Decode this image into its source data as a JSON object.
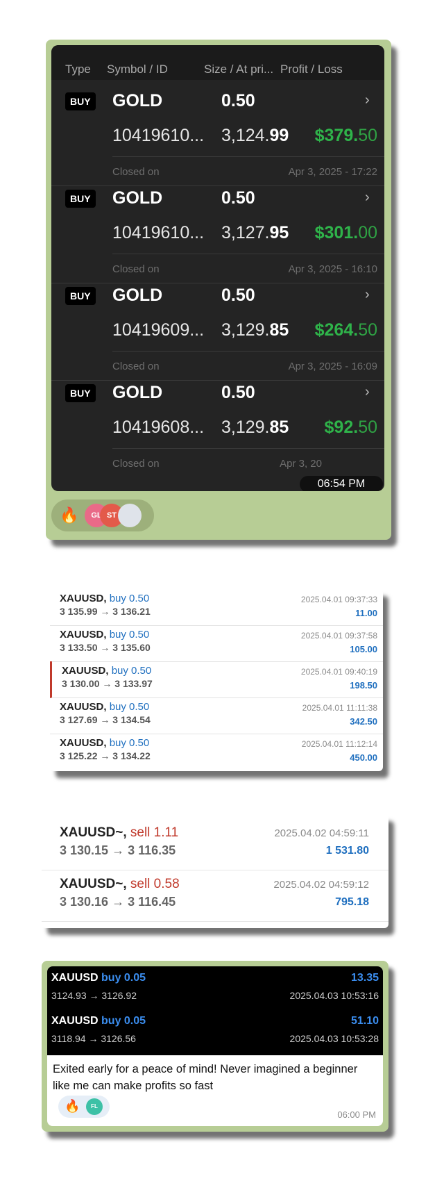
{
  "card1": {
    "headers": [
      "Type",
      "Symbol / ID",
      "Size / At pri...",
      "Profit / Loss"
    ],
    "trades": [
      {
        "type": "BUY",
        "symbol": "GOLD",
        "size": "0.50",
        "id": "10419610...",
        "price_main": "3,124.",
        "price_bold": "99",
        "profit_main": "$379.",
        "profit_cents": "50",
        "closed_label": "Closed on",
        "closed_date": "Apr 3, 2025 - 17:22"
      },
      {
        "type": "BUY",
        "symbol": "GOLD",
        "size": "0.50",
        "id": "10419610...",
        "price_main": "3,127.",
        "price_bold": "95",
        "profit_main": "$301.",
        "profit_cents": "00",
        "closed_label": "Closed on",
        "closed_date": "Apr 3, 2025 - 16:10"
      },
      {
        "type": "BUY",
        "symbol": "GOLD",
        "size": "0.50",
        "id": "10419609...",
        "price_main": "3,129.",
        "price_bold": "85",
        "profit_main": "$264.",
        "profit_cents": "50",
        "closed_label": "Closed on",
        "closed_date": "Apr 3, 2025 - 16:09"
      },
      {
        "type": "BUY",
        "symbol": "GOLD",
        "size": "0.50",
        "id": "10419608...",
        "price_main": "3,129.",
        "price_bold": "85",
        "profit_main": "$92.",
        "profit_cents": "50",
        "closed_label": "Closed on",
        "closed_date": "Apr 3, 20"
      }
    ],
    "time": "06:54 PM",
    "reactions": {
      "emoji": "fire-icon",
      "avatars": [
        "GL",
        "ST"
      ]
    }
  },
  "card2": {
    "rows": [
      {
        "symbol": "XAUUSD,",
        "side": "buy 0.50",
        "prices": "3 135.99 → 3 136.21",
        "datetime": "2025.04.01 09:37:33",
        "profit": "11.00"
      },
      {
        "symbol": "XAUUSD,",
        "side": "buy 0.50",
        "prices": "3 133.50 → 3 135.60",
        "datetime": "2025.04.01 09:37:58",
        "profit": "105.00"
      },
      {
        "symbol": "XAUUSD,",
        "side": "buy 0.50",
        "prices": "3 130.00 → 3 133.97",
        "datetime": "2025.04.01 09:40:19",
        "profit": "198.50"
      },
      {
        "symbol": "XAUUSD,",
        "side": "buy 0.50",
        "prices": "3 127.69 → 3 134.54",
        "datetime": "2025.04.01 11:11:38",
        "profit": "342.50"
      },
      {
        "symbol": "XAUUSD,",
        "side": "buy 0.50",
        "prices": "3 125.22 → 3 134.22",
        "datetime": "2025.04.01 11:12:14",
        "profit": "450.00"
      }
    ]
  },
  "card3": {
    "rows": [
      {
        "symbol": "XAUUSD~,",
        "side": "sell 1.11",
        "prices": "3 130.15 → 3 116.35",
        "datetime": "2025.04.02 04:59:11",
        "profit": "1 531.80"
      },
      {
        "symbol": "XAUUSD~,",
        "side": "sell 0.58",
        "prices": "3 130.16 → 3 116.45",
        "datetime": "2025.04.02 04:59:12",
        "profit": "795.18"
      }
    ]
  },
  "card4": {
    "rows": [
      {
        "symbol": "XAUUSD",
        "side": "buy 0.05",
        "prices": "3124.93 → 3126.92",
        "datetime": "2025.04.03 10:53:16",
        "profit": "13.35"
      },
      {
        "symbol": "XAUUSD",
        "side": "buy 0.05",
        "prices": "3118.94 → 3126.56",
        "datetime": "2025.04.03 10:53:28",
        "profit": "51.10"
      }
    ],
    "message": "Exited early for a peace of mind! Never imagined a beginner like me can make profits so fast",
    "time": "06:00 PM",
    "reactions": {
      "emoji": "fire-icon",
      "avatar": "FL"
    }
  }
}
